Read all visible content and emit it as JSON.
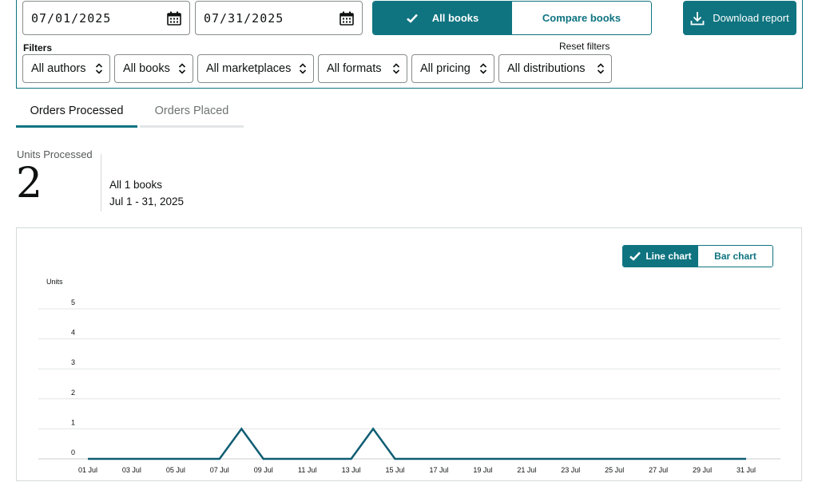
{
  "date_range": {
    "start": "07/01/2025",
    "end": "07/31/2025",
    "icon": "calendar-icon"
  },
  "book_mode": {
    "options": [
      "All books",
      "Compare books"
    ],
    "selected": "All books"
  },
  "download_button": {
    "label": "Download report",
    "icon": "download-icon"
  },
  "filters": {
    "label": "Filters",
    "reset_label": "Reset filters",
    "dropdowns": [
      "All authors",
      "All books",
      "All marketplaces",
      "All formats",
      "All pricing",
      "All distributions"
    ]
  },
  "tabs": {
    "items": [
      "Orders Processed",
      "Orders Placed"
    ],
    "active": "Orders Processed"
  },
  "summary": {
    "metric_label": "Units Processed",
    "metric_value": "2",
    "books": "All 1 books",
    "range": "Jul 1 - 31, 2025"
  },
  "chart_toggle": {
    "options": [
      "Line chart",
      "Bar chart"
    ],
    "selected": "Line chart"
  },
  "colors": {
    "accent": "#0f7480",
    "line": "#0f5d73",
    "grid": "#e3e6e6"
  },
  "chart_data": {
    "type": "line",
    "ylabel": "Units",
    "ylim": [
      0,
      5
    ],
    "yticks": [
      0,
      1,
      2,
      3,
      4,
      5
    ],
    "x_tick_labels": [
      "01 Jul",
      "03 Jul",
      "05 Jul",
      "07 Jul",
      "09 Jul",
      "11 Jul",
      "13 Jul",
      "15 Jul",
      "17 Jul",
      "19 Jul",
      "21 Jul",
      "23 Jul",
      "25 Jul",
      "27 Jul",
      "29 Jul",
      "31 Jul"
    ],
    "x": [
      1,
      2,
      3,
      4,
      5,
      6,
      7,
      8,
      9,
      10,
      11,
      12,
      13,
      14,
      15,
      16,
      17,
      18,
      19,
      20,
      21,
      22,
      23,
      24,
      25,
      26,
      27,
      28,
      29,
      30,
      31
    ],
    "series": [
      {
        "values": [
          0,
          0,
          0,
          0,
          0,
          0,
          0,
          1,
          0,
          0,
          0,
          0,
          0,
          1,
          0,
          0,
          0,
          0,
          0,
          0,
          0,
          0,
          0,
          0,
          0,
          0,
          0,
          0,
          0,
          0,
          0
        ]
      }
    ],
    "grid": true
  }
}
